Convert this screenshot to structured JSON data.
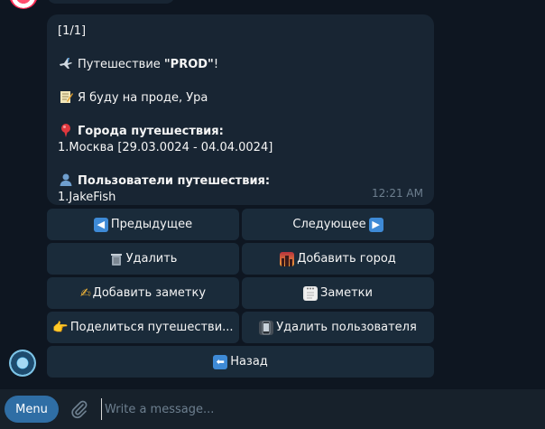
{
  "message": {
    "counter": "[1/1]",
    "trip_prefix": "Путешествие ",
    "trip_name": "\"PROD\"",
    "trip_suffix": "!",
    "note": "Я буду на проде, Ура",
    "cities_heading": "Города путешествия:",
    "city_1": "1.Москва [29.03.0024 - 04.04.0024]",
    "users_heading": "Пользователи путешествия:",
    "user_1": "1.JakeFish",
    "time": "12:21 AM",
    "icons": {
      "trip": "airplane-icon",
      "note": "memo-icon",
      "cities": "pushpin-icon",
      "users": "user-silhouette-icon"
    }
  },
  "keyboard": {
    "prev_label": "Предыдущее",
    "next_label": "Следующее",
    "delete_label": "Удалить",
    "add_city_label": "Добавить город",
    "add_note_label": "Добавить заметку",
    "notes_label": "Заметки",
    "share_label": "Поделиться путешестви...",
    "delete_user_label": "Удалить пользователя",
    "back_label": "Назад"
  },
  "input": {
    "menu_label": "Menu",
    "placeholder": "Write a message..."
  },
  "colors": {
    "background": "#0e1621",
    "bubble": "#182533",
    "button": "#1a2b3a",
    "menu_button": "#2f6ea5",
    "input_bar": "#17212b",
    "timestamp": "#6d7f8f"
  }
}
